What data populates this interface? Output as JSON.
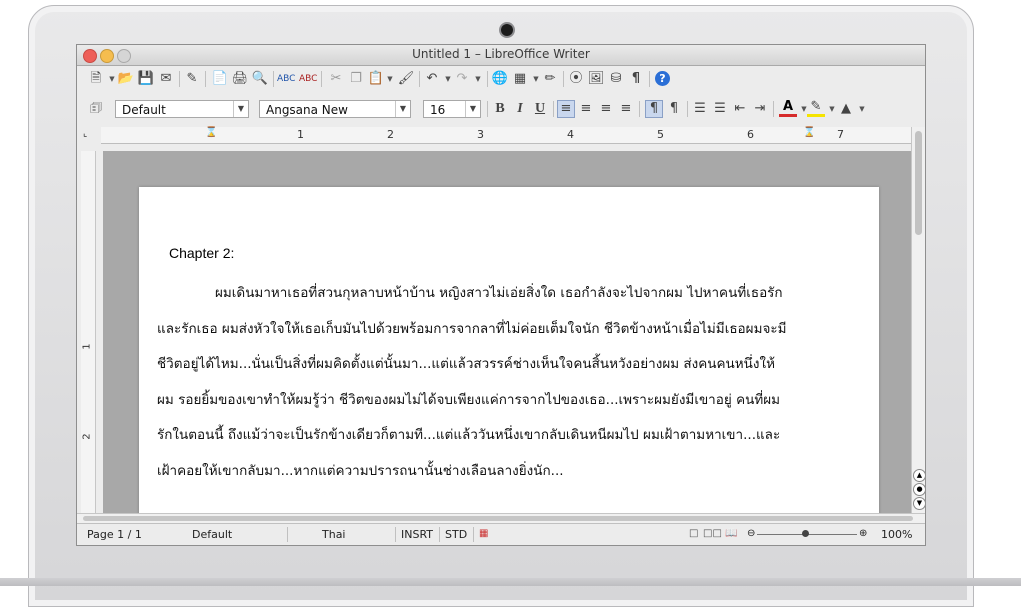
{
  "window": {
    "title": "Untitled 1 – LibreOffice Writer"
  },
  "toolbar_format": {
    "paragraph_style": "Default",
    "font_name": "Angsana New",
    "font_size": "16",
    "bold": "B",
    "italic": "I",
    "underline": "U"
  },
  "ruler": {
    "labels": [
      "1",
      "2",
      "3",
      "4",
      "5",
      "6",
      "7"
    ]
  },
  "vruler": {
    "labels": [
      "1",
      "2"
    ]
  },
  "document": {
    "heading": "Chapter 2:",
    "lines": [
      "ผมเดินมาหาเธอที่สวนกุหลาบหน้าบ้าน หญิงสาวไม่เอ่ยสิ่งใด เธอกำลังจะไปจากผม ไปหาคนที่เธอรัก",
      "และรักเธอ ผมส่งหัวใจให้เธอเก็บมันไปด้วยพร้อมการจากลาที่ไม่ค่อยเต็มใจนัก ชีวิตข้างหน้าเมื่อไม่มีเธอผมจะมี",
      "ชีวิตอยู่ได้ไหม...นั่นเป็นสิ่งที่ผมคิดตั้งแต่นั้นมา...แต่แล้วสวรรค์ช่างเห็นใจคนสิ้นหวังอย่างผม ส่งคนคนหนึ่งให้",
      "ผม  รอยยิ้มของเขาทำให้ผมรู้ว่า ชีวิตของผมไม่ได้จบเพียงแค่การจากไปของเธอ...เพราะผมยังมีเขาอยู่ คนที่ผม",
      "รักในตอนนี้ ถึงแม้ว่าจะเป็นรักข้างเดียวก็ตามที...แต่แล้ววันหนึ่งเขากลับเดินหนีผมไป ผมเฝ้าตามหาเขา...และ",
      "เฝ้าคอยให้เขากลับมา...หากแต่ความปรารถนานั้นช่างเลือนลางยิ่งนัก..."
    ]
  },
  "statusbar": {
    "page": "Page 1 / 1",
    "style": "Default",
    "language": "Thai",
    "insert_mode": "INSRT",
    "selection_mode": "STD",
    "zoom": "100%"
  }
}
